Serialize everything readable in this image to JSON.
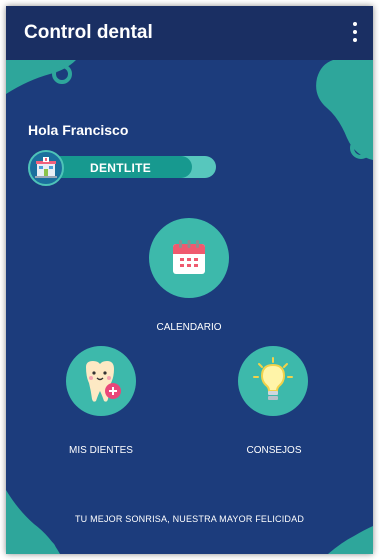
{
  "appbar": {
    "title": "Control dental"
  },
  "greeting": "Hola Francisco",
  "clinic": {
    "name": "DENTLITE",
    "icon": "clinic-building-icon"
  },
  "menu_items": [
    {
      "label": "CALENDARIO",
      "icon": "calendar-icon"
    },
    {
      "label": "MIS DIENTES",
      "icon": "tooth-add-icon"
    },
    {
      "label": "CONSEJOS",
      "icon": "lightbulb-icon"
    }
  ],
  "slogan": "TU MEJOR SONRISA, NUESTRA MAYOR FELICIDAD",
  "colors": {
    "background": "#1c3c7c",
    "appbar": "#1a2f63",
    "accent_teal": "#3db9ab",
    "deco_teal": "#2ea69b"
  }
}
